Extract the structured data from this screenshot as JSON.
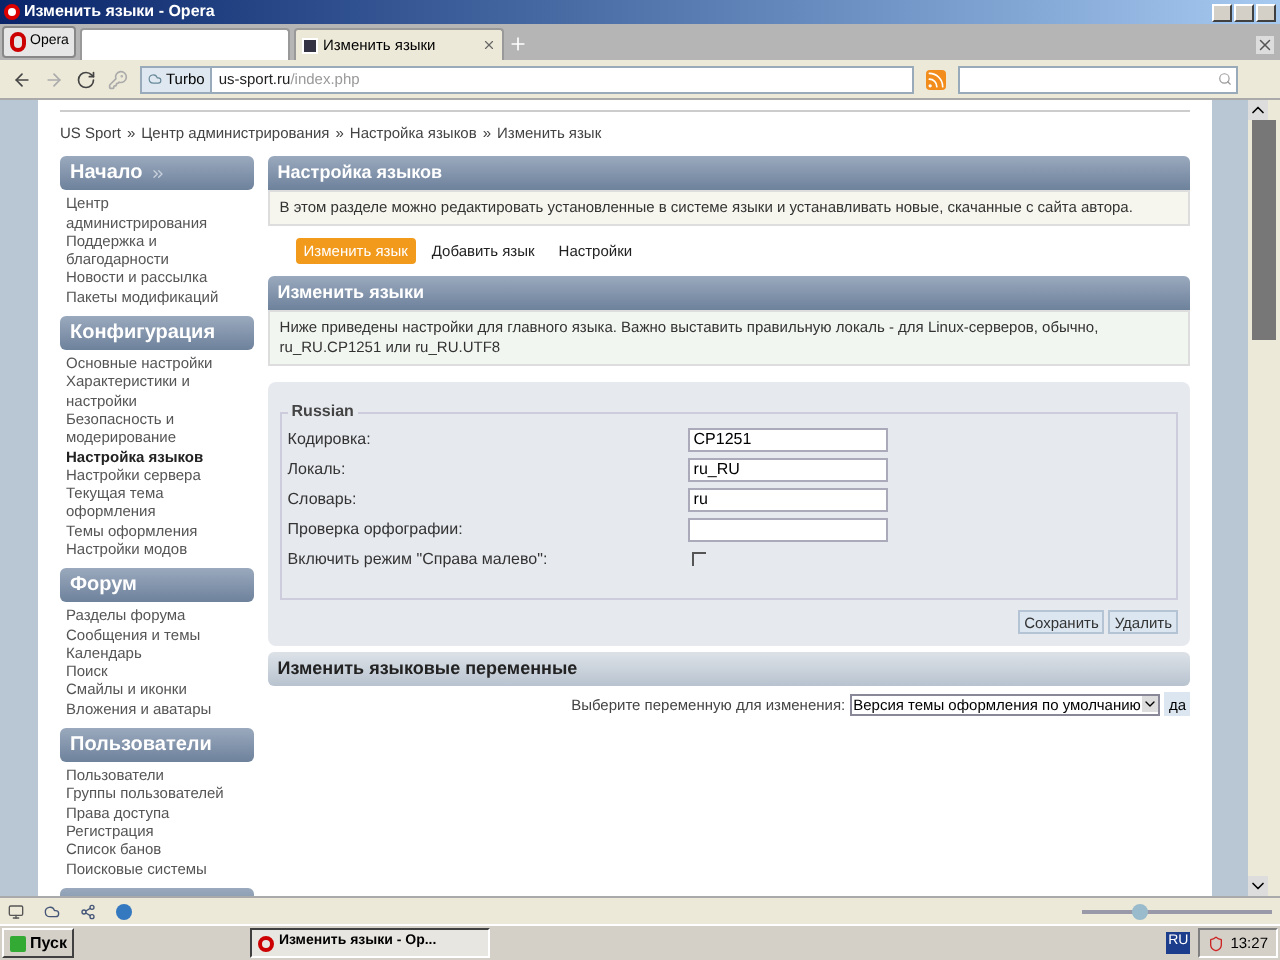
{
  "window": {
    "title": "Изменить языки - Opera",
    "menu_button": "Opera"
  },
  "browser_tabs": [
    {
      "selected": false
    },
    {
      "label": "Изменить языки",
      "selected": true
    }
  ],
  "address_bar": {
    "turbo": "Turbo",
    "url_host": "us-sport.ru",
    "url_path": "/index.php"
  },
  "breadcrumb": [
    "US Sport",
    "Центр администрирования",
    "Настройка языков",
    "Изменить язык"
  ],
  "breadcrumb_separator": "»",
  "sidebar": [
    {
      "title": "Начало",
      "items": [
        {
          "label": "Центр администрирования",
          "selected": false
        },
        {
          "label": "Поддержка и благодарности",
          "selected": false
        },
        {
          "label": "Новости и рассылка",
          "selected": false
        },
        {
          "label": "Пакеты модификаций",
          "selected": false
        }
      ]
    },
    {
      "title": "Конфигурация",
      "items": [
        {
          "label": "Основные настройки",
          "selected": false
        },
        {
          "label": "Характеристики и настройки",
          "selected": false
        },
        {
          "label": "Безопасность и модерирование",
          "selected": false
        },
        {
          "label": "Настройка языков",
          "selected": true
        },
        {
          "label": "Настройки сервера",
          "selected": false
        },
        {
          "label": "Текущая тема оформления",
          "selected": false
        },
        {
          "label": "Темы оформления",
          "selected": false
        },
        {
          "label": "Настройки модов",
          "selected": false
        }
      ]
    },
    {
      "title": "Форум",
      "items": [
        {
          "label": "Разделы форума",
          "selected": false
        },
        {
          "label": "Сообщения и темы",
          "selected": false
        },
        {
          "label": "Календарь",
          "selected": false
        },
        {
          "label": "Поиск",
          "selected": false
        },
        {
          "label": "Смайлы и иконки",
          "selected": false
        },
        {
          "label": "Вложения и аватары",
          "selected": false
        }
      ]
    },
    {
      "title": "Пользователи",
      "items": [
        {
          "label": "Пользователи",
          "selected": false
        },
        {
          "label": "Группы пользователей",
          "selected": false
        },
        {
          "label": "Права доступа",
          "selected": false
        },
        {
          "label": "Регистрация",
          "selected": false
        },
        {
          "label": "Список банов",
          "selected": false
        },
        {
          "label": "Поисковые системы",
          "selected": false
        }
      ]
    }
  ],
  "section_title": "Настройка языков",
  "section_info": "В этом разделе можно редактировать установленные в системе языки и устанавливать новые, скачанные с сайта автора.",
  "tabs": [
    {
      "label": "Изменить язык",
      "selected": true
    },
    {
      "label": "Добавить язык",
      "selected": false
    },
    {
      "label": "Настройки",
      "selected": false
    }
  ],
  "edit_title": "Изменить языки",
  "edit_info": "Ниже приведены настройки для главного языка. Важно выставить правильную локаль - для Linux-серверов, обычно, ru_RU.CP1251 или ru_RU.UTF8",
  "form": {
    "legend": "Russian",
    "fields": [
      {
        "kind": "text",
        "label": "Кодировка:",
        "value": "CP1251"
      },
      {
        "kind": "text",
        "label": "Локаль:",
        "value": "ru_RU"
      },
      {
        "kind": "text",
        "label": "Словарь:",
        "value": "ru"
      },
      {
        "kind": "text",
        "label": "Проверка орфографии:"
      },
      {
        "kind": "checkbox",
        "label": "Включить режим \"Справа малево\":",
        "checked": false
      }
    ],
    "buttons": [
      "Сохранить",
      "Удалить"
    ]
  },
  "variables": {
    "title": "Изменить языковые переменные",
    "prompt": "Выберите переменную для изменения:",
    "selected": "Версия темы оформления по умолчанию",
    "go": "да"
  },
  "status_bar": {
    "zoom": {
      "level": 0.3
    }
  },
  "taskbar": {
    "start": "Пуск",
    "tasks": [
      {
        "label": "Изменить языки - Ор...",
        "selected": true
      }
    ],
    "language": "RU",
    "clock": "13:27"
  }
}
